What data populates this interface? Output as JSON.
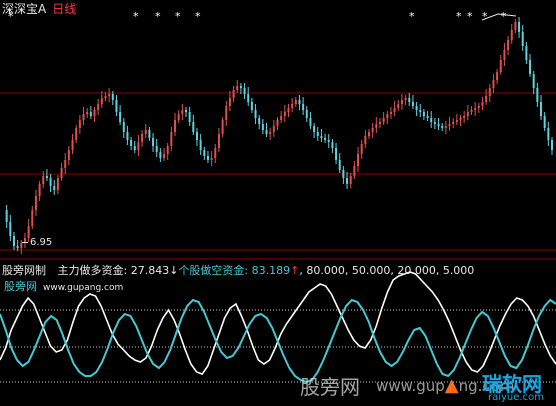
{
  "header": {
    "title": "深深宝A",
    "period": "日线"
  },
  "price_panel": {
    "low_label": "6.95",
    "star_markers": [
      "*",
      "*",
      "*",
      "*",
      "*",
      "*",
      "*",
      "*",
      "*",
      "*"
    ],
    "line_color": "#8b0000"
  },
  "indicator": {
    "name": "股旁网制",
    "bull_label": "主力做多资金:",
    "bull_value": "27.843",
    "bull_arrow": "↓",
    "bear_label": "个股做空资金:",
    "bear_value": "83.189",
    "bear_arrow": "↑",
    "refs": ", 80.000, 50.000, 20.000, 5.000"
  },
  "site": {
    "name": "股旁网",
    "url": "www.gupang.com"
  },
  "watermark": {
    "text": "股旁网",
    "url": "www.gup",
    "url2": "ng.com"
  },
  "brand": {
    "name": "瑞软网",
    "sub": "raiyue.com"
  },
  "colors": {
    "up": "#e0504f",
    "down": "#5fd3e0",
    "white_line": "#ffffff",
    "cyan_line": "#46c8d2",
    "red_guides": "#8b0000"
  }
}
